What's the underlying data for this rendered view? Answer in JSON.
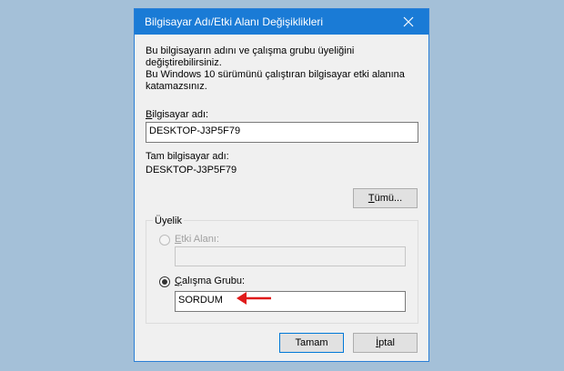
{
  "dialog": {
    "title": "Bilgisayar Adı/Etki Alanı Değişiklikleri",
    "description": "Bu bilgisayarın adını ve çalışma grubu üyeliğini değiştirebilirsiniz.\nBu Windows 10 sürümünü çalıştıran bilgisayar etki alanına\nkatamazsınız.",
    "computer_name": {
      "label_first": "B",
      "label_rest": "ilgisayar adı:",
      "value": "DESKTOP-J3P5F79"
    },
    "full_name": {
      "label": "Tam bilgisayar adı:",
      "value": "DESKTOP-J3P5F79"
    },
    "more_button": {
      "label_first": "T",
      "label_rest": "ümü..."
    },
    "membership": {
      "title": "Üyelik",
      "domain": {
        "label_first": "E",
        "label_rest": "tki Alanı:",
        "value": "",
        "selected": false,
        "enabled": false
      },
      "workgroup": {
        "label_first": "Ç",
        "label_rest": "alışma Grubu:",
        "value": "SORDUM",
        "selected": true
      }
    },
    "ok_button": "Tamam",
    "cancel_button": {
      "label_first": "İ",
      "label_rest": "ptal"
    }
  },
  "colors": {
    "desktop": "#a4c0d8",
    "titlebar": "#1a7bd6",
    "arrow": "#e01b1b"
  }
}
